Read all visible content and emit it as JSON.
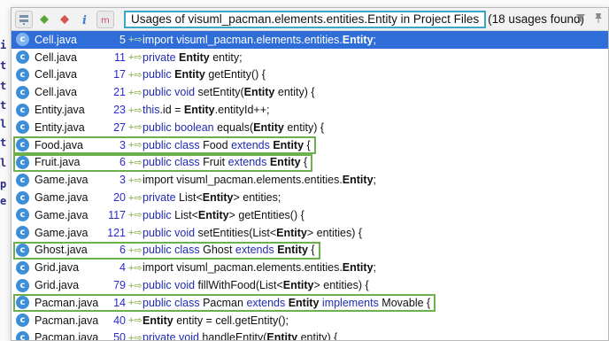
{
  "background": {
    "gutter_chars": [
      "i",
      "t",
      "t",
      "t",
      "l",
      "t",
      "l",
      "p",
      "e"
    ]
  },
  "toolbar": {
    "title": "Usages of visuml_pacman.elements.entities.Entity in Project Files",
    "count": "(18 usages found)",
    "buttons": [
      "merge-icon",
      "expand-icon",
      "collapse-icon",
      "info-icon",
      "method-icon"
    ],
    "right_icons": [
      "filter-icon",
      "pin-icon"
    ]
  },
  "colors": {
    "selection": "#2f6ed8",
    "highlight_border": "#6ab04c",
    "title_border": "#37a8c6"
  },
  "rows": [
    {
      "file": "Cell.java",
      "line": "5",
      "code": [
        [
          "import visuml_pacman.elements.entities.",
          "n"
        ],
        [
          "Entity",
          "b"
        ],
        [
          ";",
          "n"
        ]
      ],
      "selected": true
    },
    {
      "file": "Cell.java",
      "line": "11",
      "code": [
        [
          "private ",
          "k"
        ],
        [
          "Entity",
          "b"
        ],
        [
          " entity;",
          "n"
        ]
      ]
    },
    {
      "file": "Cell.java",
      "line": "17",
      "code": [
        [
          "public ",
          "k"
        ],
        [
          "Entity",
          "b"
        ],
        [
          " getEntity() {",
          "n"
        ]
      ]
    },
    {
      "file": "Cell.java",
      "line": "21",
      "code": [
        [
          "public void ",
          "k"
        ],
        [
          "setEntity(",
          "n"
        ],
        [
          "Entity",
          "b"
        ],
        [
          " entity) {",
          "n"
        ]
      ]
    },
    {
      "file": "Entity.java",
      "line": "23",
      "code": [
        [
          "this",
          "k"
        ],
        [
          ".id = ",
          "n"
        ],
        [
          "Entity",
          "b"
        ],
        [
          ".entityId++;",
          "n"
        ]
      ]
    },
    {
      "file": "Entity.java",
      "line": "27",
      "code": [
        [
          "public boolean ",
          "k"
        ],
        [
          "equals(",
          "n"
        ],
        [
          "Entity",
          "b"
        ],
        [
          " entity) {",
          "n"
        ]
      ]
    },
    {
      "file": "Food.java",
      "line": "3",
      "code": [
        [
          "public class ",
          "k"
        ],
        [
          "Food ",
          "n"
        ],
        [
          "extends ",
          "k"
        ],
        [
          "Entity",
          "b"
        ],
        [
          " {",
          "n"
        ]
      ],
      "boxed": true
    },
    {
      "file": "Fruit.java",
      "line": "6",
      "code": [
        [
          "public class ",
          "k"
        ],
        [
          "Fruit ",
          "n"
        ],
        [
          "extends ",
          "k"
        ],
        [
          "Entity",
          "b"
        ],
        [
          " {",
          "n"
        ]
      ],
      "boxed": true
    },
    {
      "file": "Game.java",
      "line": "3",
      "code": [
        [
          "import visuml_pacman.elements.entities.",
          "n"
        ],
        [
          "Entity",
          "b"
        ],
        [
          ";",
          "n"
        ]
      ]
    },
    {
      "file": "Game.java",
      "line": "20",
      "code": [
        [
          "private ",
          "k"
        ],
        [
          "List<",
          "n"
        ],
        [
          "Entity",
          "b"
        ],
        [
          "> entities;",
          "n"
        ]
      ]
    },
    {
      "file": "Game.java",
      "line": "117",
      "code": [
        [
          "public ",
          "k"
        ],
        [
          "List<",
          "n"
        ],
        [
          "Entity",
          "b"
        ],
        [
          "> getEntities() {",
          "n"
        ]
      ]
    },
    {
      "file": "Game.java",
      "line": "121",
      "code": [
        [
          "public void ",
          "k"
        ],
        [
          "setEntities(List<",
          "n"
        ],
        [
          "Entity",
          "b"
        ],
        [
          "> entities) {",
          "n"
        ]
      ]
    },
    {
      "file": "Ghost.java",
      "line": "6",
      "code": [
        [
          "public class ",
          "k"
        ],
        [
          "Ghost ",
          "n"
        ],
        [
          "extends ",
          "k"
        ],
        [
          "Entity",
          "b"
        ],
        [
          " {",
          "n"
        ]
      ],
      "boxed": true
    },
    {
      "file": "Grid.java",
      "line": "4",
      "code": [
        [
          "import visuml_pacman.elements.entities.",
          "n"
        ],
        [
          "Entity",
          "b"
        ],
        [
          ";",
          "n"
        ]
      ]
    },
    {
      "file": "Grid.java",
      "line": "79",
      "code": [
        [
          "public void ",
          "k"
        ],
        [
          "fillWithFood(List<",
          "n"
        ],
        [
          "Entity",
          "b"
        ],
        [
          "> entities) {",
          "n"
        ]
      ]
    },
    {
      "file": "Pacman.java",
      "line": "14",
      "code": [
        [
          "public class ",
          "k"
        ],
        [
          "Pacman ",
          "n"
        ],
        [
          "extends ",
          "k"
        ],
        [
          "Entity",
          "b"
        ],
        [
          " implements ",
          "k"
        ],
        [
          "Movable {",
          "n"
        ]
      ],
      "boxed": true
    },
    {
      "file": "Pacman.java",
      "line": "40",
      "code": [
        [
          "Entity",
          "b"
        ],
        [
          " entity = cell.getEntity();",
          "n"
        ]
      ]
    },
    {
      "file": "Pacman.java",
      "line": "50",
      "code": [
        [
          "private void ",
          "k"
        ],
        [
          "handleEntity(",
          "n"
        ],
        [
          "Entity",
          "b"
        ],
        [
          " entity) {",
          "n"
        ]
      ]
    }
  ]
}
